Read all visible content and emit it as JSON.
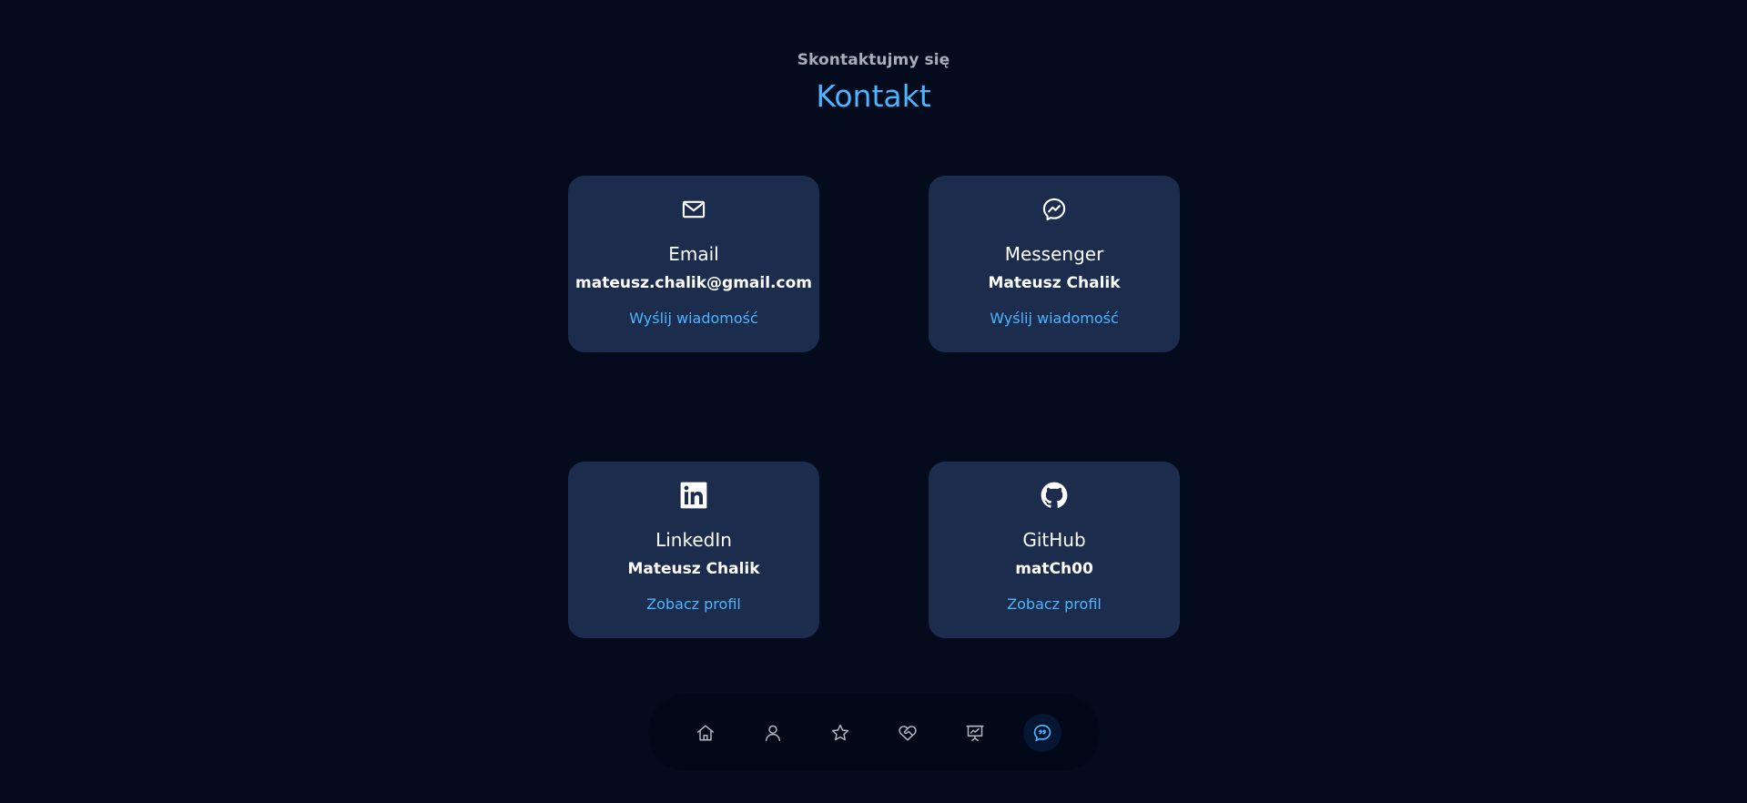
{
  "header": {
    "subtitle": "Skontaktujmy się",
    "title": "Kontakt"
  },
  "cards": [
    {
      "icon": "mail-icon",
      "label": "Email",
      "value": "mateusz.chalik@gmail.com",
      "link": "Wyślij wiadomość"
    },
    {
      "icon": "messenger-icon",
      "label": "Messenger",
      "value": "Mateusz Chalik",
      "link": "Wyślij wiadomość"
    },
    {
      "icon": "linkedin-icon",
      "label": "LinkedIn",
      "value": "Mateusz Chalik",
      "link": "Zobacz profil"
    },
    {
      "icon": "github-icon",
      "label": "GitHub",
      "value": "matCh00",
      "link": "Zobacz profil"
    }
  ],
  "nav": {
    "items": [
      {
        "icon": "home-icon"
      },
      {
        "icon": "user-icon"
      },
      {
        "icon": "star-icon"
      },
      {
        "icon": "heart-handshake-icon"
      },
      {
        "icon": "presentation-icon"
      },
      {
        "icon": "chat-icon",
        "active": true
      }
    ]
  },
  "colors": {
    "background": "#040b1c",
    "card": "#1b2c4c",
    "accent": "#4db5ff",
    "subtitle": "#a8adb8",
    "nav_bg": "#020817",
    "nav_icon": "#b3b8c2"
  }
}
